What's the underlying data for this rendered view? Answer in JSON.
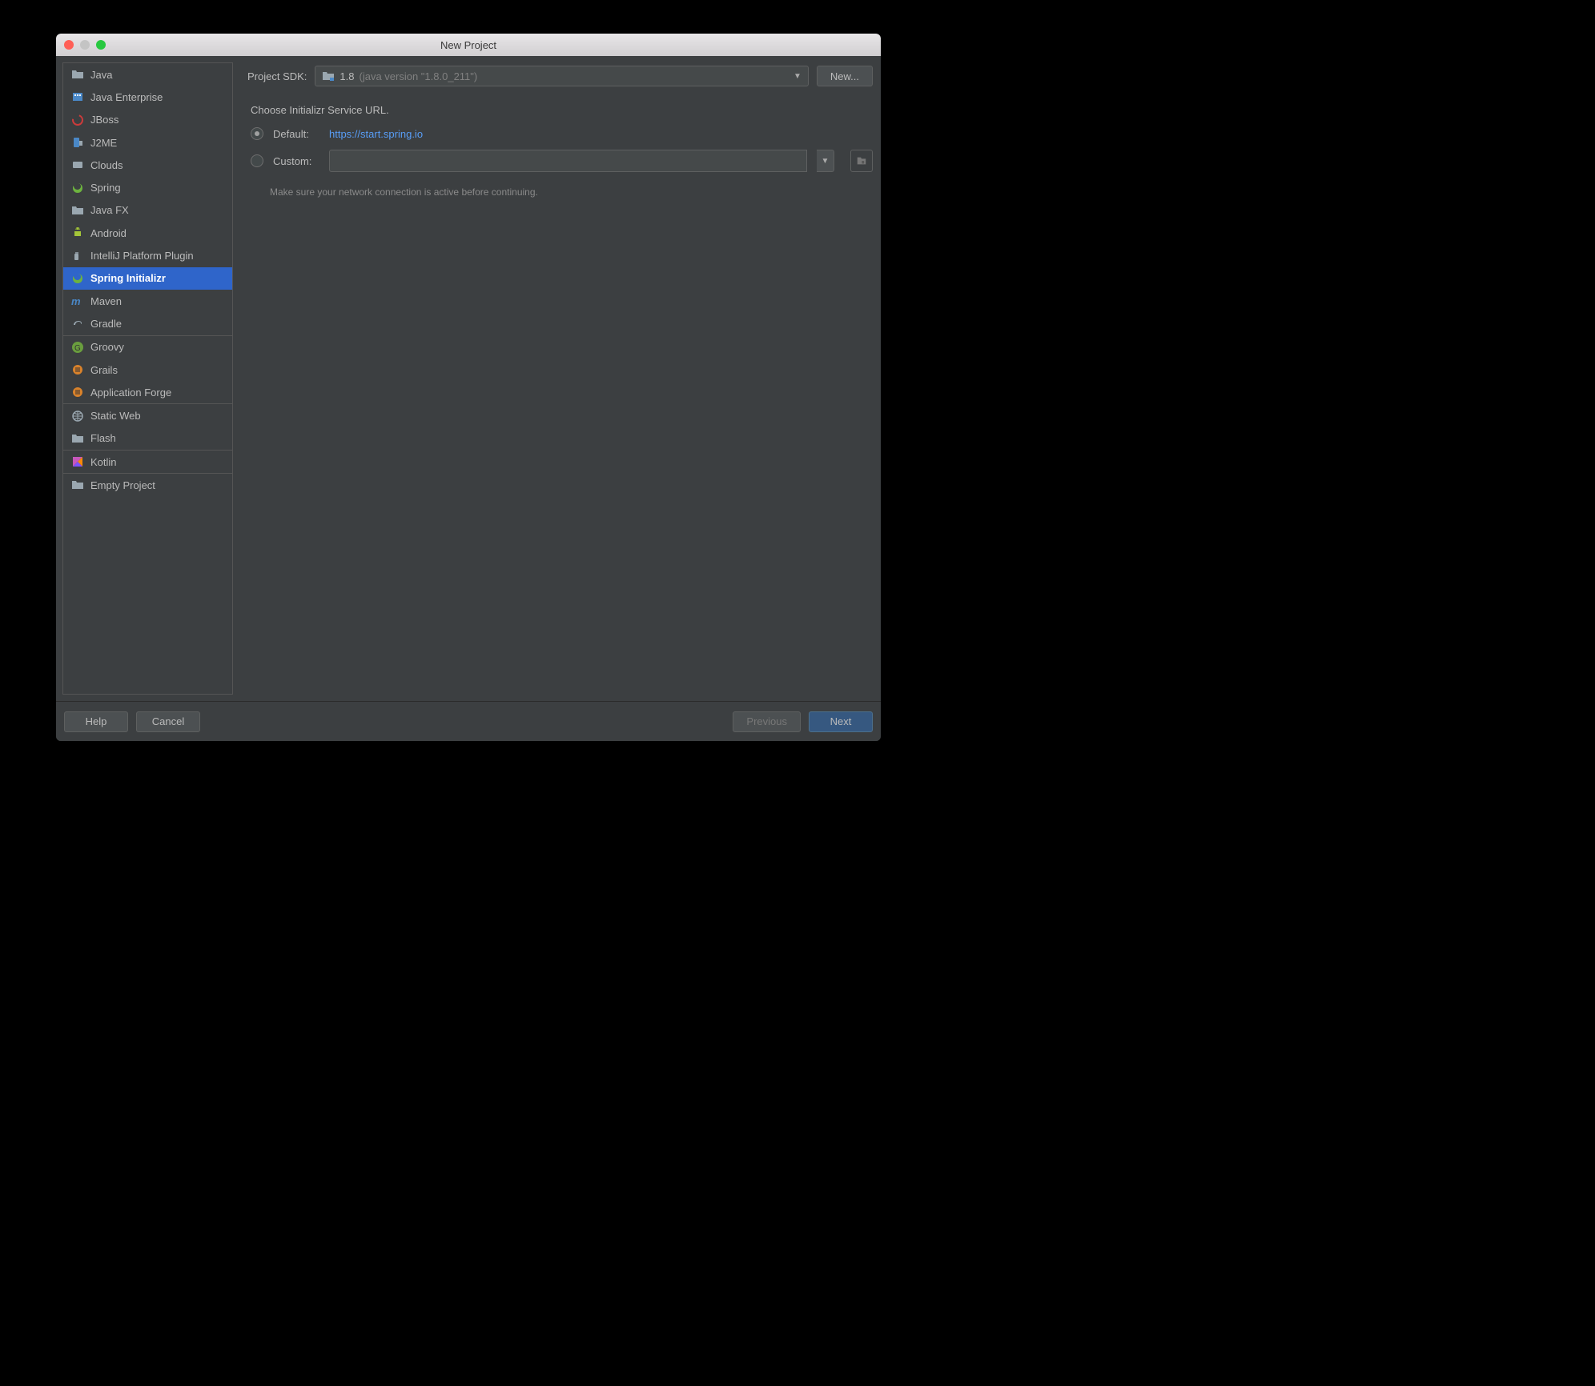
{
  "window": {
    "title": "New Project"
  },
  "sidebar": {
    "groups": [
      [
        {
          "id": "java",
          "label": "Java",
          "iconColor": "#9aa7b0"
        },
        {
          "id": "java-enterprise",
          "label": "Java Enterprise",
          "iconColor": "#4a88c7"
        },
        {
          "id": "jboss",
          "label": "JBoss",
          "iconColor": "#cc3b3b"
        },
        {
          "id": "j2me",
          "label": "J2ME",
          "iconColor": "#4a88c7"
        },
        {
          "id": "clouds",
          "label": "Clouds",
          "iconColor": "#9aa7b0"
        },
        {
          "id": "spring",
          "label": "Spring",
          "iconColor": "#6db33f"
        },
        {
          "id": "javafx",
          "label": "Java FX",
          "iconColor": "#9aa7b0"
        },
        {
          "id": "android",
          "label": "Android",
          "iconColor": "#a4c639"
        },
        {
          "id": "intellij-plugin",
          "label": "IntelliJ Platform Plugin",
          "iconColor": "#9aa7b0"
        },
        {
          "id": "spring-initializr",
          "label": "Spring Initializr",
          "iconColor": "#6db33f",
          "selected": true
        },
        {
          "id": "maven",
          "label": "Maven",
          "iconColor": "#4a88c7"
        },
        {
          "id": "gradle",
          "label": "Gradle",
          "iconColor": "#9aa7b0"
        }
      ],
      [
        {
          "id": "groovy",
          "label": "Groovy",
          "iconColor": "#6a9e3e"
        },
        {
          "id": "grails",
          "label": "Grails",
          "iconColor": "#d9822b"
        },
        {
          "id": "app-forge",
          "label": "Application Forge",
          "iconColor": "#d9822b"
        }
      ],
      [
        {
          "id": "static-web",
          "label": "Static Web",
          "iconColor": "#9aa7b0"
        },
        {
          "id": "flash",
          "label": "Flash",
          "iconColor": "#9aa7b0"
        }
      ],
      [
        {
          "id": "kotlin",
          "label": "Kotlin",
          "iconColor": "#c757bc"
        }
      ],
      [
        {
          "id": "empty",
          "label": "Empty Project",
          "iconColor": "#9aa7b0"
        }
      ]
    ]
  },
  "main": {
    "sdkLabel": "Project SDK:",
    "sdkVersion": "1.8",
    "sdkDetail": "(java version \"1.8.0_211\")",
    "newButton": "New...",
    "sectionTitle": "Choose Initializr Service URL.",
    "defaultLabel": "Default:",
    "defaultUrl": "https://start.spring.io",
    "customLabel": "Custom:",
    "hint": "Make sure your network connection is active before continuing."
  },
  "footer": {
    "help": "Help",
    "cancel": "Cancel",
    "previous": "Previous",
    "next": "Next"
  }
}
